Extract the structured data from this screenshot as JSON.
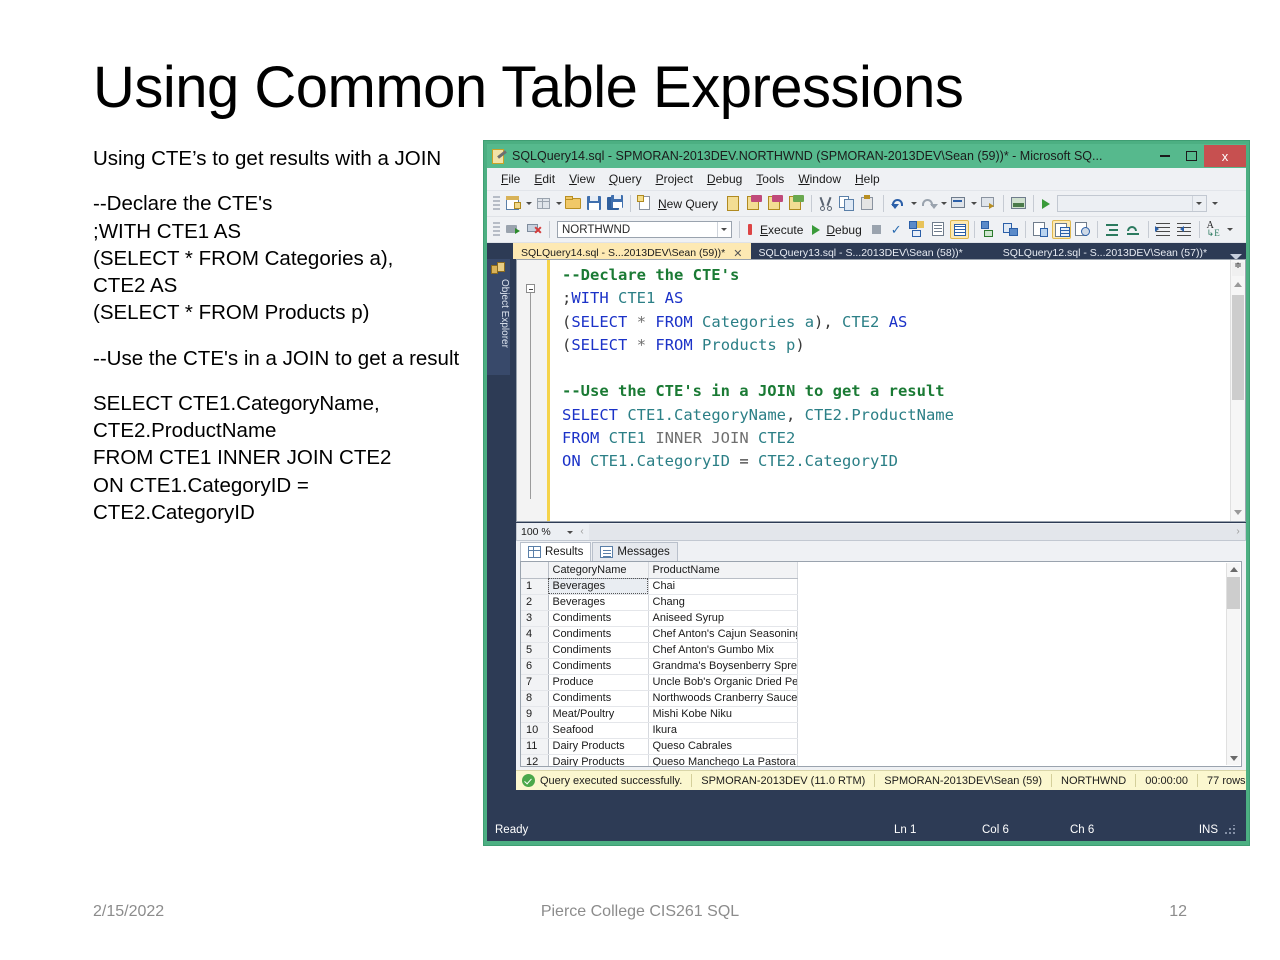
{
  "slide": {
    "title": "Using Common Table Expressions",
    "paragraphs": [
      "Using CTE’s to get results with a JOIN",
      "--Declare the CTE's\n;WITH CTE1 AS\n(SELECT * FROM Categories a),\nCTE2 AS\n(SELECT * FROM Products p)",
      "--Use the CTE's in a JOIN to get a result",
      "SELECT CTE1.CategoryName,\nCTE2.ProductName\nFROM CTE1 INNER JOIN CTE2\nON CTE1.CategoryID =\nCTE2.CategoryID"
    ],
    "footer": {
      "date": "2/15/2022",
      "center": "Pierce College CIS261 SQL",
      "page": "12"
    }
  },
  "ssms": {
    "title": "SQLQuery14.sql - SPMORAN-2013DEV.NORTHWND (SPMORAN-2013DEV\\Sean (59))* - Microsoft SQ...",
    "window_buttons": {
      "minimize": "minimize-icon",
      "maximize": "maximize-icon",
      "close": "x"
    },
    "menu": [
      {
        "label": "File",
        "accel": "F",
        "rest": "ile"
      },
      {
        "label": "Edit",
        "accel": "E",
        "rest": "dit"
      },
      {
        "label": "View",
        "accel": "V",
        "rest": "iew"
      },
      {
        "label": "Query",
        "accel": "Q",
        "rest": "uery"
      },
      {
        "label": "Project",
        "accel": "P",
        "rest": "roject"
      },
      {
        "label": "Debug",
        "accel": "D",
        "rest": "ebug"
      },
      {
        "label": "Tools",
        "accel": "T",
        "rest": "ools"
      },
      {
        "label": "Window",
        "accel": "W",
        "rest": "indow"
      },
      {
        "label": "Help",
        "accel": "H",
        "rest": "elp"
      }
    ],
    "toolbar1": {
      "new_query_label": "New Query",
      "new_query_accel": "N",
      "new_query_rest": "ew Query",
      "zoom_combo_value": ""
    },
    "toolbar2": {
      "database_combo_value": "NORTHWND",
      "execute_label": "Execute",
      "execute_accel": "E",
      "execute_rest": "xecute",
      "debug_label": "Debug",
      "debug_accel": "D",
      "debug_rest": "ebug"
    },
    "object_explorer": {
      "label": "Object Explorer"
    },
    "doc_tabs": [
      {
        "label": "SQLQuery14.sql - S...2013DEV\\Sean (59))*",
        "active": true,
        "close": "✕"
      },
      {
        "label": "SQLQuery13.sql - S...2013DEV\\Sean (58))*",
        "active": false
      },
      {
        "label": "SQLQuery12.sql - S...2013DEV\\Sean (57))*",
        "active": false
      }
    ],
    "editor": {
      "lines": [
        [
          {
            "t": "--Declare the CTE's",
            "c": "c"
          }
        ],
        [
          {
            "t": ";",
            "c": "p"
          },
          {
            "t": "WITH",
            "c": "k"
          },
          {
            "t": " CTE1 ",
            "c": "t"
          },
          {
            "t": "AS",
            "c": "k"
          }
        ],
        [
          {
            "t": "(",
            "c": "p"
          },
          {
            "t": "SELECT",
            "c": "k"
          },
          {
            "t": " ",
            "c": "p"
          },
          {
            "t": "*",
            "c": "g"
          },
          {
            "t": " ",
            "c": "p"
          },
          {
            "t": "FROM",
            "c": "k"
          },
          {
            "t": " ",
            "c": "p"
          },
          {
            "t": "Categories",
            "c": "t"
          },
          {
            "t": " a",
            "c": "t"
          },
          {
            "t": "), ",
            "c": "p"
          },
          {
            "t": "CTE2 ",
            "c": "t"
          },
          {
            "t": "AS",
            "c": "k"
          }
        ],
        [
          {
            "t": "(",
            "c": "p"
          },
          {
            "t": "SELECT",
            "c": "k"
          },
          {
            "t": " ",
            "c": "p"
          },
          {
            "t": "*",
            "c": "g"
          },
          {
            "t": " ",
            "c": "p"
          },
          {
            "t": "FROM",
            "c": "k"
          },
          {
            "t": " ",
            "c": "p"
          },
          {
            "t": "Products",
            "c": "t"
          },
          {
            "t": " p",
            "c": "t"
          },
          {
            "t": ")",
            "c": "p"
          }
        ],
        [],
        [
          {
            "t": "--Use the CTE's in a JOIN to get a result",
            "c": "c"
          }
        ],
        [
          {
            "t": "SELECT",
            "c": "k"
          },
          {
            "t": " ",
            "c": "p"
          },
          {
            "t": "CTE1.CategoryName",
            "c": "t"
          },
          {
            "t": ", ",
            "c": "p"
          },
          {
            "t": "CTE2.ProductName",
            "c": "t"
          }
        ],
        [
          {
            "t": "FROM",
            "c": "k"
          },
          {
            "t": " ",
            "c": "p"
          },
          {
            "t": "CTE1",
            "c": "t"
          },
          {
            "t": " ",
            "c": "p"
          },
          {
            "t": "INNER JOIN",
            "c": "g"
          },
          {
            "t": " ",
            "c": "p"
          },
          {
            "t": "CTE2",
            "c": "t"
          }
        ],
        [
          {
            "t": "ON",
            "c": "k"
          },
          {
            "t": " ",
            "c": "p"
          },
          {
            "t": "CTE1.CategoryID",
            "c": "t"
          },
          {
            "t": " = ",
            "c": "p"
          },
          {
            "t": "CTE2.CategoryID",
            "c": "t"
          }
        ]
      ],
      "zoom_level": "100 %"
    },
    "result_tabs": [
      {
        "label": "Results",
        "icon": "grid-icon",
        "active": true
      },
      {
        "label": "Messages",
        "icon": "messages-icon",
        "active": false
      }
    ],
    "grid": {
      "columns": [
        "",
        "CategoryName",
        "ProductName"
      ],
      "rows": [
        [
          "1",
          "Beverages",
          "Chai"
        ],
        [
          "2",
          "Beverages",
          "Chang"
        ],
        [
          "3",
          "Condiments",
          "Aniseed Syrup"
        ],
        [
          "4",
          "Condiments",
          "Chef Anton's Cajun Seasoning"
        ],
        [
          "5",
          "Condiments",
          "Chef Anton's Gumbo Mix"
        ],
        [
          "6",
          "Condiments",
          "Grandma's Boysenberry Spread"
        ],
        [
          "7",
          "Produce",
          "Uncle Bob's Organic Dried Pears"
        ],
        [
          "8",
          "Condiments",
          "Northwoods Cranberry Sauce"
        ],
        [
          "9",
          "Meat/Poultry",
          "Mishi Kobe Niku"
        ],
        [
          "10",
          "Seafood",
          "Ikura"
        ],
        [
          "11",
          "Dairy Products",
          "Queso Cabrales"
        ],
        [
          "12",
          "Dairy Products",
          "Queso Manchego La Pastora"
        ]
      ],
      "selected_row": 0
    },
    "query_status": {
      "message": "Query executed successfully.",
      "server": "SPMORAN-2013DEV (11.0 RTM)",
      "user": "SPMORAN-2013DEV\\Sean (59)",
      "database": "NORTHWND",
      "elapsed": "00:00:00",
      "rows": "77 rows"
    },
    "app_status": {
      "ready": "Ready",
      "line": "Ln 1",
      "col": "Col 6",
      "ch": "Ch 6",
      "mode": "INS"
    }
  }
}
